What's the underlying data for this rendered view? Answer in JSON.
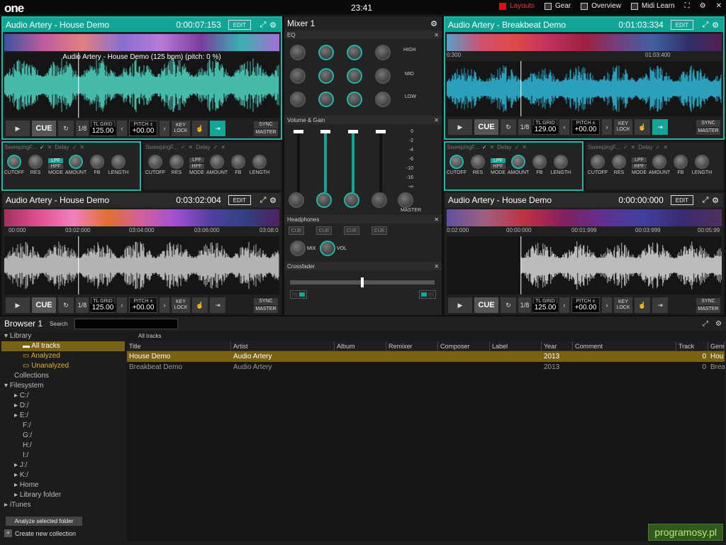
{
  "topbar": {
    "logo": "one",
    "clock": "23:41",
    "nav": [
      {
        "label": "Layouts"
      },
      {
        "label": "Gear"
      },
      {
        "label": "Overview"
      },
      {
        "label": "Midi Learn"
      }
    ]
  },
  "deckA": {
    "title": "Audio Artery - House Demo",
    "time": "0:00:07:153",
    "edit": "EDIT",
    "wave_title": "Audio Artery - House Demo (125 bpm) (pitch: 0 %)",
    "loop": "1/8",
    "grid_label": "TL GRID",
    "bpm": "125.00",
    "pitch_label": "PITCH ±",
    "pitch": "+00.00",
    "keylock": "KEY LOCK",
    "sync": "SYNC",
    "master": "MASTER",
    "cue": "CUE"
  },
  "deckB": {
    "title": "Audio Artery - Breakbeat Demo",
    "time": "0:01:03:334",
    "edit": "EDIT",
    "ruler": [
      "0:300",
      "01:03:400"
    ],
    "loop": "1/8",
    "grid_label": "TL GRID",
    "bpm": "129.00",
    "pitch_label": "PITCH ±",
    "pitch": "+00.00",
    "keylock": "KEY LOCK",
    "sync": "SYNC",
    "master": "MASTER",
    "cue": "CUE"
  },
  "deckC": {
    "title": "Audio Artery - House Demo",
    "time": "0:03:02:004",
    "edit": "EDIT",
    "ruler": [
      "00:000",
      "03:02:000",
      "03:04:000",
      "03:06:000",
      "03:08:0"
    ],
    "loop": "1/8",
    "grid_label": "TL GRID",
    "bpm": "125.00",
    "pitch_label": "PITCH ±",
    "pitch": "+00.00",
    "keylock": "KEY LOCK",
    "sync": "SYNC",
    "master": "MASTER",
    "cue": "CUE"
  },
  "deckD": {
    "title": "Audio Artery - House Demo",
    "time": "0:00:00:000",
    "edit": "EDIT",
    "ruler": [
      "0:02:000",
      "00:00:000",
      "00:01:999",
      "00:03:999",
      "00:05:99"
    ],
    "loop": "1/8",
    "grid_label": "TL GRID",
    "bpm": "125.00",
    "pitch_label": "PITCH ±",
    "pitch": "+00.00",
    "keylock": "KEY LOCK",
    "sync": "SYNC",
    "master": "MASTER",
    "cue": "CUE"
  },
  "fx": {
    "sweep": "SweepingF...",
    "delay": "Delay",
    "cutoff": "CUTOFF",
    "res": "RES",
    "mode": "MODE",
    "lpf": "LPF",
    "hpf": "HPF",
    "amount": "AMOUNT",
    "fb": "FB",
    "length": "LENGTH"
  },
  "mixer": {
    "title": "Mixer 1",
    "eq": "EQ",
    "high": "HIGH",
    "mid": "MID",
    "low": "LOW",
    "vol": "Volume & Gain",
    "meter": [
      "0",
      "-2",
      "-4",
      "-6",
      "-10",
      "-16",
      "-∞"
    ],
    "master": "MASTER",
    "headphones": "Headphones",
    "cue": "CUE",
    "mix": "MIX",
    "volk": "VOL",
    "crossfader": "Crossfader"
  },
  "browser": {
    "title": "Browser 1",
    "search": "Search",
    "tab": "All tracks",
    "tree": [
      {
        "label": "Library"
      },
      {
        "label": "All tracks"
      },
      {
        "label": "Analyzed"
      },
      {
        "label": "Unanalyzed"
      },
      {
        "label": "Collections"
      },
      {
        "label": "Filesystem"
      },
      {
        "label": "C:/"
      },
      {
        "label": "D:/"
      },
      {
        "label": "E:/"
      },
      {
        "label": "F:/"
      },
      {
        "label": "G:/"
      },
      {
        "label": "H:/"
      },
      {
        "label": "I:/"
      },
      {
        "label": "J:/"
      },
      {
        "label": "K:/"
      },
      {
        "label": "Home"
      },
      {
        "label": "Library folder"
      },
      {
        "label": "iTunes"
      }
    ],
    "analyze": "Analyze selected folder",
    "create": "Create new collection",
    "columns": [
      "Title",
      "Artist",
      "Album",
      "Remixer",
      "Composer",
      "Label",
      "Year",
      "Comment",
      "Track",
      "Genr"
    ],
    "rows": [
      {
        "title": "House Demo",
        "artist": "Audio Artery",
        "year": "2013",
        "track": "0",
        "genre": "Hou"
      },
      {
        "title": "Breakbeat Demo",
        "artist": "Audio Artery",
        "year": "2013",
        "track": "0",
        "genre": "Brea"
      }
    ]
  },
  "watermark": "programosy.pl"
}
